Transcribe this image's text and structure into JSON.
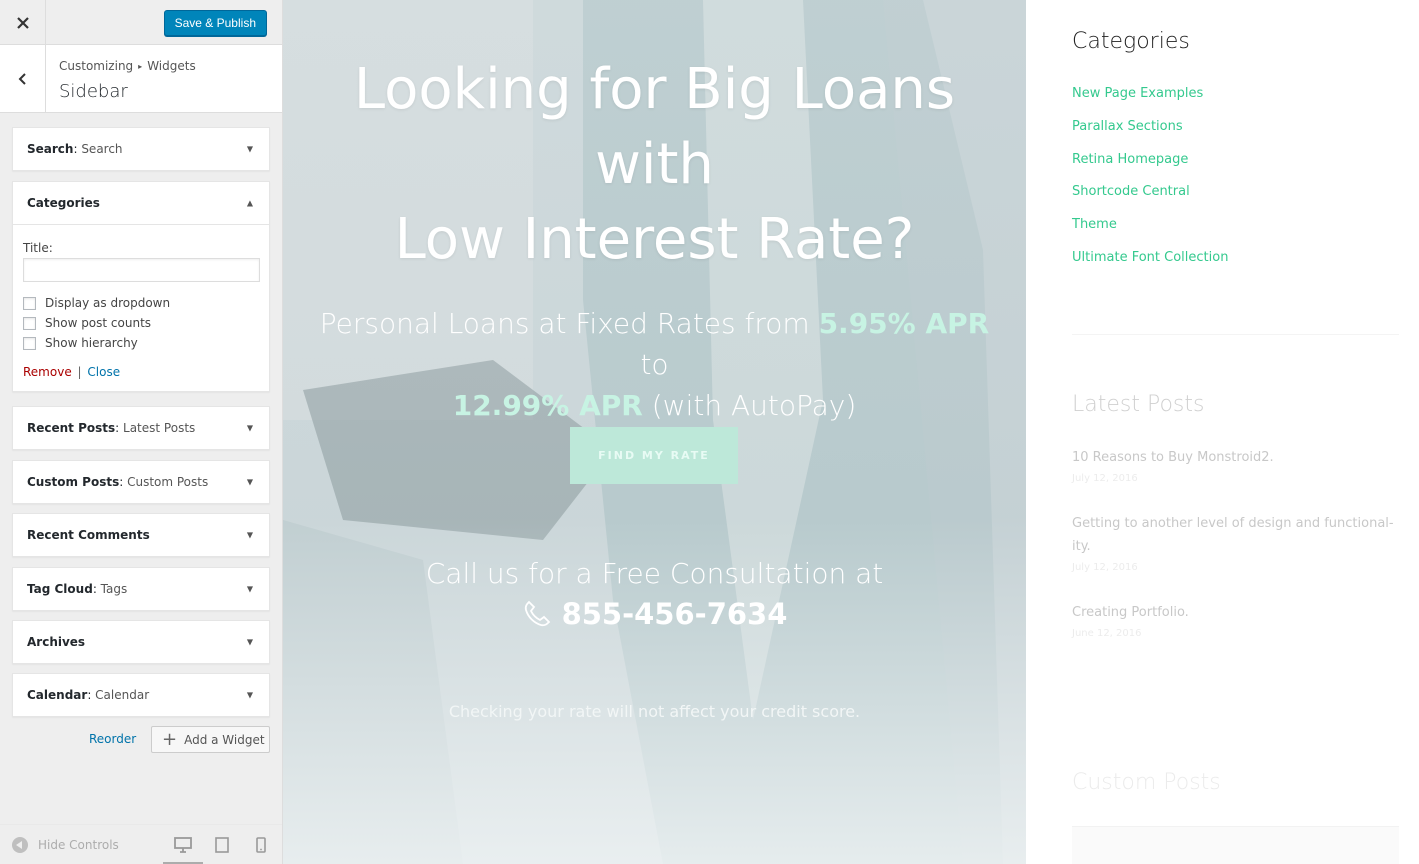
{
  "customizer": {
    "save_label": "Save & Publish",
    "breadcrumb": [
      "Customizing",
      "Widgets"
    ],
    "section_title": "Sidebar",
    "widgets": [
      {
        "name": "Search",
        "sub": "Search"
      },
      {
        "name": "Categories",
        "sub": ""
      },
      {
        "name": "Recent Posts",
        "sub": "Latest Posts"
      },
      {
        "name": "Custom Posts",
        "sub": "Custom Posts"
      },
      {
        "name": "Recent Comments",
        "sub": ""
      },
      {
        "name": "Tag Cloud",
        "sub": "Tags"
      },
      {
        "name": "Archives",
        "sub": ""
      },
      {
        "name": "Calendar",
        "sub": "Calendar"
      }
    ],
    "categories_form": {
      "title_label": "Title:",
      "title_value": "",
      "options": [
        "Display as dropdown",
        "Show post counts",
        "Show hierarchy"
      ],
      "remove_label": "Remove",
      "separator": "|",
      "close_label": "Close"
    },
    "reorder_label": "Reorder",
    "add_widget_label": "Add a Widget",
    "hide_controls_label": "Hide Controls"
  },
  "hero": {
    "title_lines": [
      "Looking for Big Loans",
      "with",
      "Low Interest Rate?"
    ],
    "sub_pre": "Personal Loans at Fixed Rates from ",
    "apr_low": "5.95% APR",
    "sub_mid": " to",
    "apr_high": "12.99% APR",
    "sub_post": " (with AutoPay)",
    "cta_label": "FIND MY RATE",
    "call_text": "Call us for a Free Consultation at",
    "phone": "855-456-7634",
    "note": "Checking your rate will not affect your credit score."
  },
  "right_sidebar": {
    "categories_title": "Categories",
    "categories": [
      "New Page Examples",
      "Parallax Sections",
      "Retina Homepage",
      "Shortcode Central",
      "Theme",
      "Ultimate Font Collection"
    ],
    "latest_title": "Latest Posts",
    "posts": [
      {
        "title": "10 Reasons to Buy Monstroid2.",
        "date": "July 12, 2016"
      },
      {
        "title": "Getting to another level of design and functional-ity.",
        "date": "July 12, 2016"
      },
      {
        "title": "Creating Portfolio.",
        "date": "June 12, 2016"
      }
    ],
    "custom_posts_title": "Custom Posts"
  },
  "colors": {
    "primary_button": "#0085ba",
    "link_green": "#34c98e",
    "apr_highlight": "#c7f3e3",
    "remove_red": "#aa0000",
    "link_blue": "#0073aa"
  }
}
